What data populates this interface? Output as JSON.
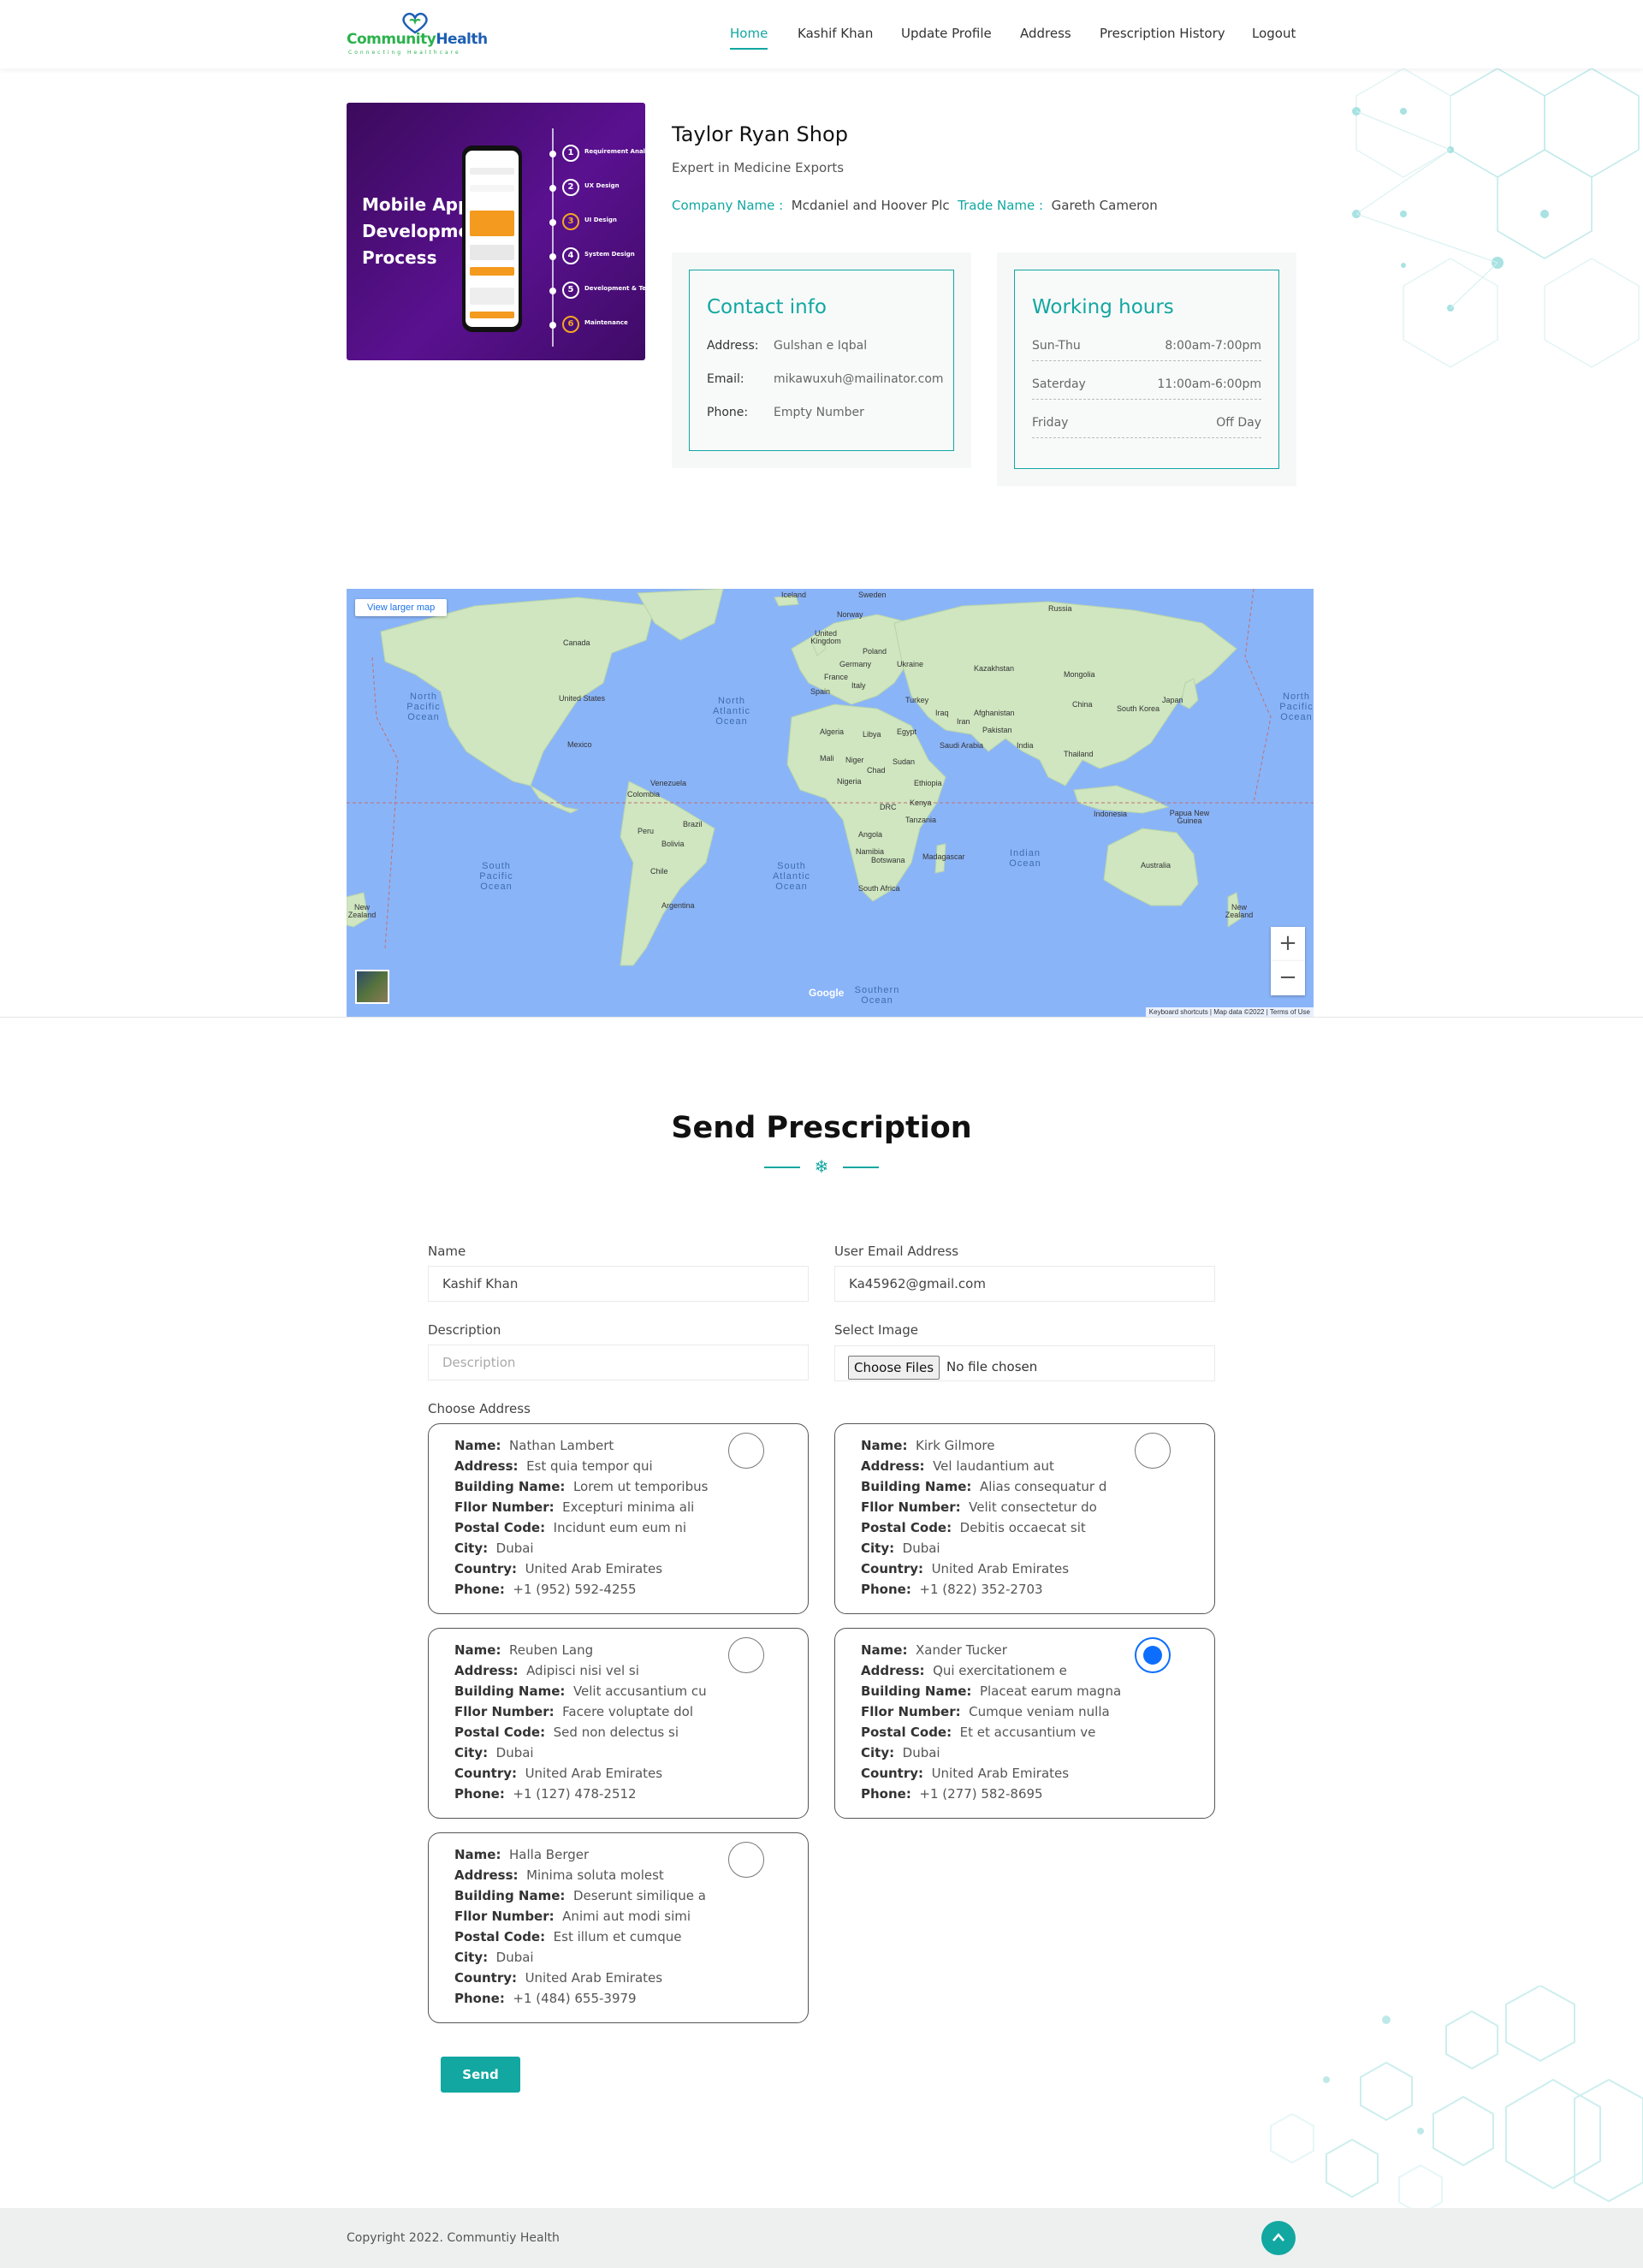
{
  "brand": {
    "name_part1": "Community",
    "name_part2": "Health",
    "tagline": "Connecting Healthcare",
    "color_green": "#2bb24c",
    "color_blue": "#1e5fb3"
  },
  "nav": {
    "items": [
      {
        "label": "Home",
        "active": true
      },
      {
        "label": "Kashif Khan",
        "active": false
      },
      {
        "label": "Update Profile",
        "active": false
      },
      {
        "label": "Address",
        "active": false
      },
      {
        "label": "Prescription History",
        "active": false
      },
      {
        "label": "Logout",
        "active": false
      }
    ]
  },
  "shop": {
    "image": {
      "title": "Mobile App Development Process",
      "steps": [
        {
          "num": "1",
          "label": "Requirement Analysis"
        },
        {
          "num": "2",
          "label": "UX Design"
        },
        {
          "num": "3",
          "label": "UI Design"
        },
        {
          "num": "4",
          "label": "System Design"
        },
        {
          "num": "5",
          "label": "Development & Testing"
        },
        {
          "num": "6",
          "label": "Maintenance"
        }
      ]
    },
    "name": "Taylor Ryan Shop",
    "tagline": "Expert in Medicine Exports",
    "company_label": "Company Name :",
    "company_value": "Mcdaniel and Hoover Plc",
    "trade_label": "Trade Name :",
    "trade_value": "Gareth Cameron"
  },
  "contact": {
    "title": "Contact info",
    "address_label": "Address:",
    "address_value": "Gulshan e Iqbal",
    "email_label": "Email:",
    "email_value": "mikawuxuh@mailinator.com",
    "phone_label": "Phone:",
    "phone_value": "Empty Number"
  },
  "hours": {
    "title": "Working hours",
    "rows": [
      {
        "day": "Sun-Thu",
        "time": "8:00am-7:00pm"
      },
      {
        "day": "Saterday",
        "time": "11:00am-6:00pm"
      },
      {
        "day": "Friday",
        "time": "Off Day"
      }
    ]
  },
  "map": {
    "view_larger": "View larger map",
    "zoom_in": "+",
    "zoom_out": "−",
    "google": "Google",
    "footer": "Keyboard shortcuts | Map data ©2022 | Terms of Use",
    "labels": {
      "iceland": "Iceland",
      "sweden": "Sweden",
      "norway": "Norway",
      "russia": "Russia",
      "uk": "United Kingdom",
      "poland": "Poland",
      "germany": "Germany",
      "ukraine": "Ukraine",
      "france": "France",
      "kazakhstan": "Kazakhstan",
      "mongolia": "Mongolia",
      "spain": "Spain",
      "italy": "Italy",
      "turkey": "Turkey",
      "china": "China",
      "south_korea": "South Korea",
      "japan": "Japan",
      "afghanistan": "Afghanistan",
      "iraq": "Iraq",
      "iran": "Iran",
      "pakistan": "Pakistan",
      "algeria": "Algeria",
      "libya": "Libya",
      "egypt": "Egypt",
      "saudi": "Saudi Arabia",
      "india": "India",
      "thailand": "Thailand",
      "mali": "Mali",
      "niger": "Niger",
      "sudan": "Sudan",
      "chad": "Chad",
      "nigeria": "Nigeria",
      "ethiopia": "Ethiopia",
      "drc": "DRC",
      "kenya": "Kenya",
      "tanzania": "Tanzania",
      "angola": "Angola",
      "namibia": "Namibia",
      "botswana": "Botswana",
      "madagascar": "Madagascar",
      "south_africa": "South Africa",
      "indonesia": "Indonesia",
      "png": "Papua New Guinea",
      "australia": "Australia",
      "new_zealand_east": "New Zealand",
      "new_zealand_west": "New Zealand",
      "canada": "Canada",
      "usa": "United States",
      "mexico": "Mexico",
      "venezuela": "Venezuela",
      "colombia": "Colombia",
      "peru": "Peru",
      "brazil": "Brazil",
      "bolivia": "Bolivia",
      "chile": "Chile",
      "argentina": "Argentina"
    },
    "oceans": {
      "north_pacific": "North Pacific Ocean",
      "north_pacific_east": "North Pacific Ocean",
      "north_atlantic": "North Atlantic Ocean",
      "south_pacific": "South Pacific Ocean",
      "south_atlantic": "South Atlantic Ocean",
      "indian": "Indian Ocean",
      "southern": "Southern Ocean"
    }
  },
  "prescription": {
    "title": "Send Prescription",
    "name_label": "Name",
    "name_value": "Kashif Khan",
    "email_label": "User Email Address",
    "email_value": "Ka45962@gmail.com",
    "description_label": "Description",
    "description_placeholder": "Description",
    "image_label": "Select Image",
    "file_button": "Choose Files",
    "file_status": "No file chosen",
    "address_label": "Choose Address",
    "field_labels": {
      "name": "Name:",
      "address": "Address:",
      "building": "Building Name:",
      "floor": "Fllor Number:",
      "postal": "Postal Code:",
      "city": "City:",
      "country": "Country:",
      "phone": "Phone:"
    },
    "addresses": [
      {
        "name": "Nathan Lambert",
        "address": "Est quia tempor qui",
        "building": "Lorem ut temporibus",
        "floor": "Excepturi minima ali",
        "postal": "Incidunt eum eum ni",
        "city": "Dubai",
        "country": "United Arab Emirates",
        "phone": "+1 (952) 592-4255",
        "selected": false
      },
      {
        "name": "Kirk Gilmore",
        "address": "Vel laudantium aut",
        "building": "Alias consequatur d",
        "floor": "Velit consectetur do",
        "postal": "Debitis occaecat sit",
        "city": "Dubai",
        "country": "United Arab Emirates",
        "phone": "+1 (822) 352-2703",
        "selected": false
      },
      {
        "name": "Reuben Lang",
        "address": "Adipisci nisi vel si",
        "building": "Velit accusantium cu",
        "floor": "Facere voluptate dol",
        "postal": "Sed non delectus si",
        "city": "Dubai",
        "country": "United Arab Emirates",
        "phone": "+1 (127) 478-2512",
        "selected": false
      },
      {
        "name": "Xander Tucker",
        "address": "Qui exercitationem e",
        "building": "Placeat earum magna",
        "floor": "Cumque veniam nulla",
        "postal": "Et et accusantium ve",
        "city": "Dubai",
        "country": "United Arab Emirates",
        "phone": "+1 (277) 582-8695",
        "selected": true
      },
      {
        "name": "Halla Berger",
        "address": "Minima soluta molest",
        "building": "Deserunt similique a",
        "floor": "Animi aut modi simi",
        "postal": "Est illum et cumque",
        "city": "Dubai",
        "country": "United Arab Emirates",
        "phone": "+1 (484) 655-3979",
        "selected": false
      }
    ],
    "send_label": "Send"
  },
  "footer": {
    "copyright": "Copyright 2022. Communtiy Health"
  },
  "colors": {
    "accent": "#12a7a1",
    "radio_selected": "#0d6efd",
    "map_water": "#8ab4f8",
    "map_land": "#cfe6c0"
  }
}
